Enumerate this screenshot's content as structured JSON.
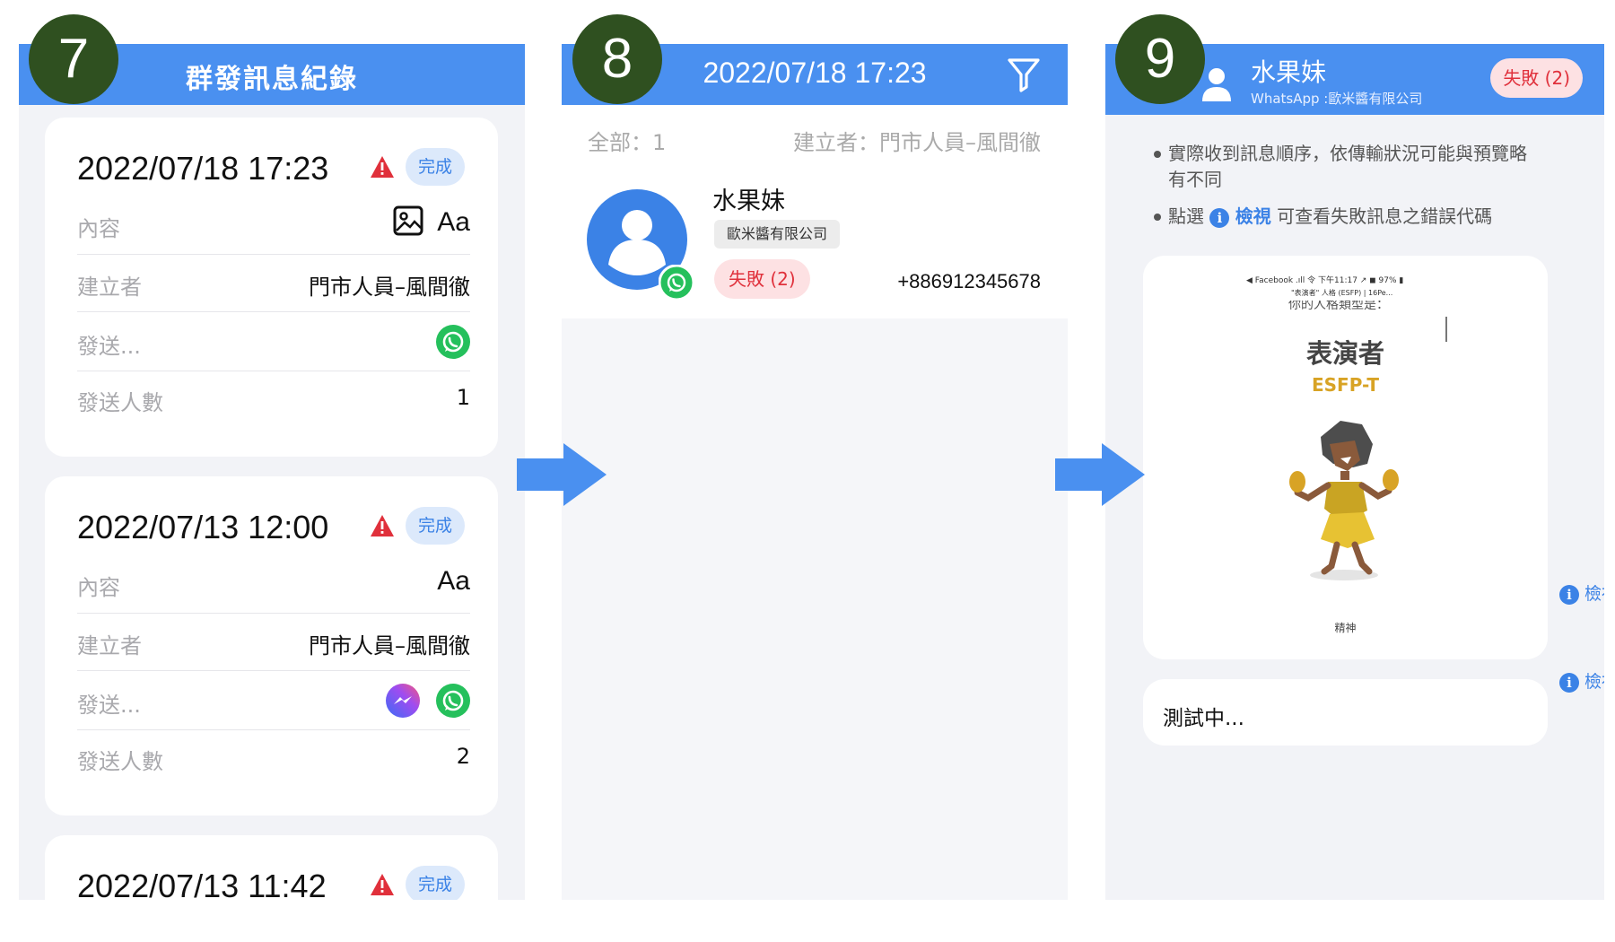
{
  "steps": [
    "7",
    "8",
    "9"
  ],
  "panel7": {
    "title": "群發訊息紀錄",
    "labels": {
      "content": "內容",
      "creator": "建立者",
      "send": "發送...",
      "recipients": "發送人數"
    },
    "cards": [
      {
        "date": "2022/07/18 17:23",
        "status": "完成",
        "creator": "門市人員–風間徹",
        "recipients": "1",
        "channels": [
          "whatsapp"
        ],
        "content_types": [
          "image",
          "text"
        ]
      },
      {
        "date": "2022/07/13 12:00",
        "status": "完成",
        "creator": "門市人員–風間徹",
        "recipients": "2",
        "channels": [
          "messenger",
          "whatsapp"
        ],
        "content_types": [
          "text"
        ]
      },
      {
        "date": "2022/07/13 11:42",
        "status": "完成"
      }
    ],
    "text_icon": "Aa"
  },
  "panel8": {
    "title": "2022/07/18 17:23",
    "count": "全部：1",
    "creator": "建立者：門市人員–風間徹",
    "contact": {
      "name": "水果妹",
      "org": "歐米醬有限公司",
      "status": "失敗 (2)",
      "phone": "+886912345678"
    }
  },
  "panel9": {
    "name": "水果妹",
    "subtitle": "WhatsApp :歐米醬有限公司",
    "status": "失敗 (2)",
    "note1": "實際收到訊息順序，依傳輸狀況可能與預覽略有不同",
    "note2_pre": "點選",
    "note2_link": "檢視",
    "note2_post": "可查看失敗訊息之錯誤代碼",
    "image_msg": {
      "status_bar": "◀ Facebook .ıll 令   下午11:17        ↗ ◼ 97% ▮",
      "sub": "\"表演者\" 人格 (ESFP) | 16Pe...",
      "cut_text": "你的人格類型是：",
      "title": "表演者",
      "code": "ESFP-T",
      "caption": "精神"
    },
    "text_msg": "測試中...",
    "view_link": "檢視"
  },
  "colors": {
    "header": "#4a90f0",
    "step": "#2f5020",
    "accent": "#3b82e6",
    "fail": "#e0303b",
    "whatsapp": "#25c05c"
  }
}
